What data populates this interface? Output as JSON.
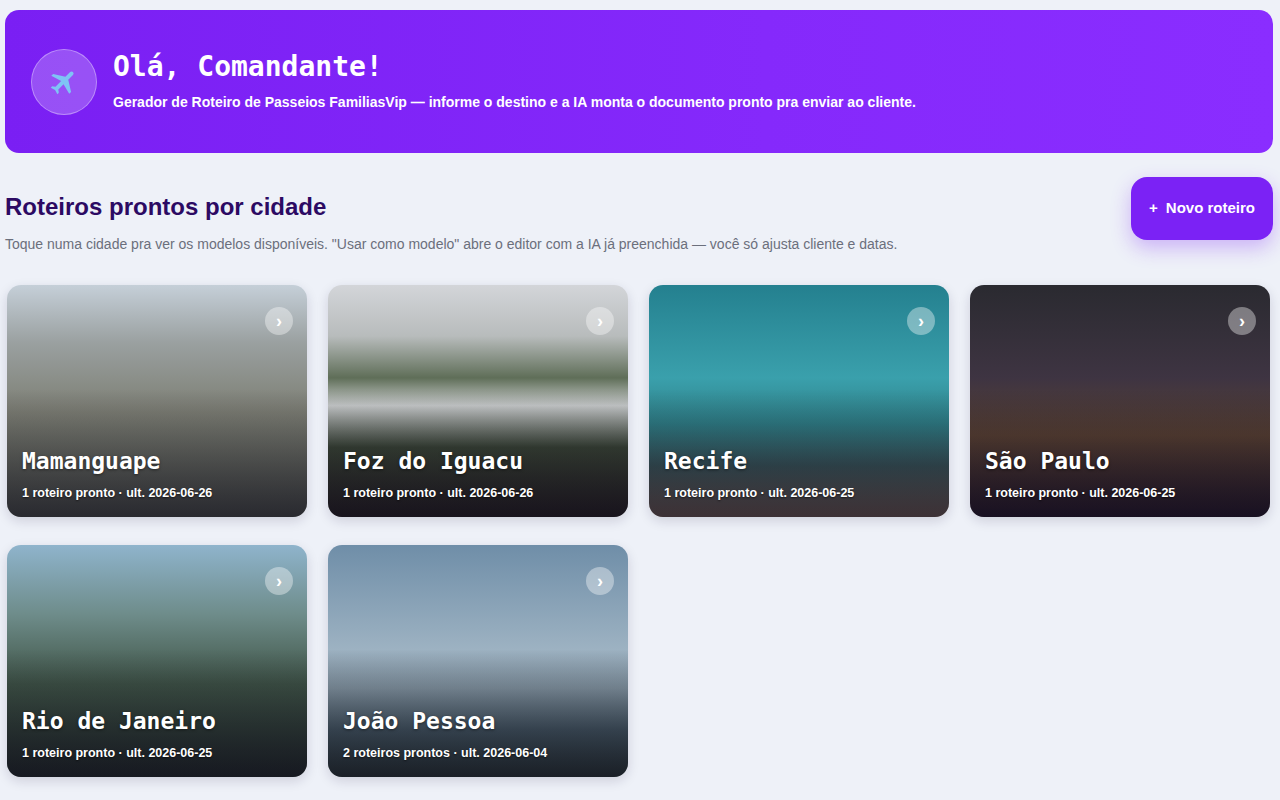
{
  "header": {
    "title": "Olá, Comandante!",
    "subtitle": "Gerador de Roteiro de Passeios FamiliasVip — informe o destino e a IA monta o documento pronto pra enviar ao cliente."
  },
  "section": {
    "title": "Roteiros prontos por cidade",
    "subtitle": "Toque numa cidade pra ver os modelos disponíveis. \"Usar como modelo\" abre o editor com a IA já preenchida — você só ajusta cliente e datas."
  },
  "new_button": {
    "icon": "+",
    "label": "Novo roteiro"
  },
  "cities": [
    {
      "name": "Mamanguape",
      "meta": "1 roteiro pronto · ult. 2026-06-26",
      "chevron": "›"
    },
    {
      "name": "Foz do Iguacu",
      "meta": "1 roteiro pronto · ult. 2026-06-26",
      "chevron": "›"
    },
    {
      "name": "Recife",
      "meta": "1 roteiro pronto · ult. 2026-06-25",
      "chevron": "›"
    },
    {
      "name": "São Paulo",
      "meta": "1 roteiro pronto · ult. 2026-06-25",
      "chevron": "›"
    },
    {
      "name": "Rio de Janeiro",
      "meta": "1 roteiro pronto · ult. 2026-06-25",
      "chevron": "›"
    },
    {
      "name": "João Pessoa",
      "meta": "2 roteiros prontos · ult. 2026-06-04",
      "chevron": "›"
    }
  ]
}
